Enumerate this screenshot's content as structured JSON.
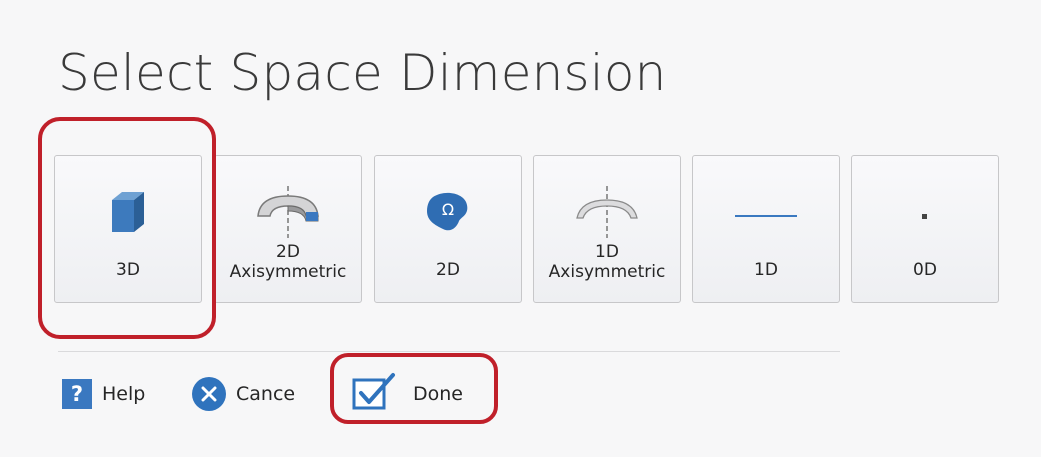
{
  "title": "Select Space Dimension",
  "dimensions": [
    {
      "label": "3D",
      "icon": "cube-icon"
    },
    {
      "label": "2D\nAxisymmetric",
      "icon": "axisymmetric-2d-icon"
    },
    {
      "label": "2D",
      "icon": "omega-domain-icon"
    },
    {
      "label": "1D\nAxisymmetric",
      "icon": "axisymmetric-1d-icon"
    },
    {
      "label": "1D",
      "icon": "line-icon"
    },
    {
      "label": "0D",
      "icon": "point-icon"
    }
  ],
  "footer": {
    "help_label": "Help",
    "help_glyph": "?",
    "cancel_label": "Cance",
    "done_label": "Done"
  },
  "colors": {
    "accent_blue": "#2f73bd",
    "highlight_red": "#c0202a"
  }
}
